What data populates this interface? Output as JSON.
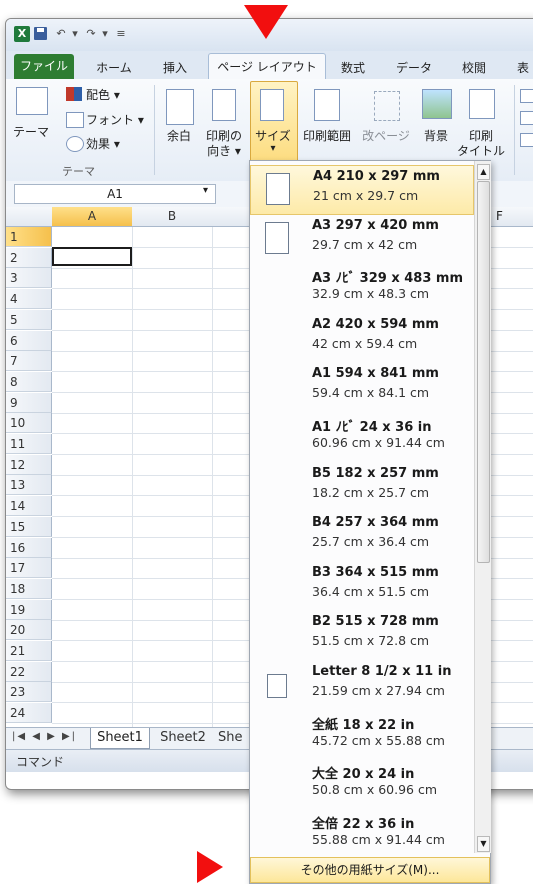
{
  "tabs": [
    "ファイル",
    "ホーム",
    "挿入",
    "ページ レイアウト",
    "数式",
    "データ",
    "校閲",
    "表"
  ],
  "ribbon": {
    "theme_label": "テーマ",
    "colors_label": "配色 ▾",
    "fonts_label": "フォント ▾",
    "effects_label": "効果 ▾",
    "group_theme": "テーマ",
    "margins_label": "余白",
    "orientation_label1": "印刷の",
    "orientation_label2": "向き ▾",
    "size_label": "サイズ",
    "print_area_label": "印刷範囲",
    "breaks_label": "改ページ",
    "background_label": "背景",
    "print_titles_label1": "印刷",
    "print_titles_label2": "タイトル"
  },
  "formula_bar": {
    "name_box": "A1"
  },
  "grid": {
    "columns": [
      "A",
      "B",
      "F"
    ],
    "rows": [
      "1",
      "2",
      "3",
      "4",
      "5",
      "6",
      "7",
      "8",
      "9",
      "10",
      "11",
      "12",
      "13",
      "14",
      "15",
      "16",
      "17",
      "18",
      "19",
      "20",
      "21",
      "22",
      "23",
      "24"
    ]
  },
  "sheets": [
    "Sheet1",
    "Sheet2",
    "She"
  ],
  "status": {
    "mode": "コマンド"
  },
  "size_menu": {
    "items": [
      {
        "title": "A4 210 x 297 mm",
        "sub": "21 cm x 29.7 cm",
        "icon": "portrait-page-icon"
      },
      {
        "title": "A3 297 x 420 mm",
        "sub": "29.7 cm x 42 cm",
        "icon": "portrait-page-icon"
      },
      {
        "title": "A3 ﾉﾋﾞ 329 x 483 mm",
        "sub": "32.9 cm x 48.3 cm",
        "icon": ""
      },
      {
        "title": "A2 420 x 594 mm",
        "sub": "42 cm x 59.4 cm",
        "icon": ""
      },
      {
        "title": "A1 594 x 841 mm",
        "sub": "59.4 cm x 84.1 cm",
        "icon": ""
      },
      {
        "title": "A1 ﾉﾋﾞ 24 x 36 in",
        "sub": "60.96 cm x 91.44 cm",
        "icon": ""
      },
      {
        "title": "B5 182 x 257 mm",
        "sub": "18.2 cm x 25.7 cm",
        "icon": ""
      },
      {
        "title": "B4 257 x 364 mm",
        "sub": "25.7 cm x 36.4 cm",
        "icon": ""
      },
      {
        "title": "B3 364 x 515 mm",
        "sub": "36.4 cm x 51.5 cm",
        "icon": ""
      },
      {
        "title": "B2 515 x 728 mm",
        "sub": "51.5 cm x 72.8 cm",
        "icon": ""
      },
      {
        "title": "Letter 8 1/2 x 11 in",
        "sub": "21.59 cm x 27.94 cm",
        "icon": "letter-page-icon"
      },
      {
        "title": "全紙 18 x 22 in",
        "sub": "45.72 cm x 55.88 cm",
        "icon": ""
      },
      {
        "title": "大全 20 x 24 in",
        "sub": "50.8 cm x 60.96 cm",
        "icon": ""
      },
      {
        "title": "全倍 22 x 36 in",
        "sub": "55.88 cm x 91.44 cm",
        "icon": ""
      }
    ],
    "more_label": "その他の用紙サイズ(M)..."
  },
  "colors": {
    "file_tab": "#2e7d32",
    "highlight": "#fde79a",
    "annotation_red": "#f20f0f"
  }
}
